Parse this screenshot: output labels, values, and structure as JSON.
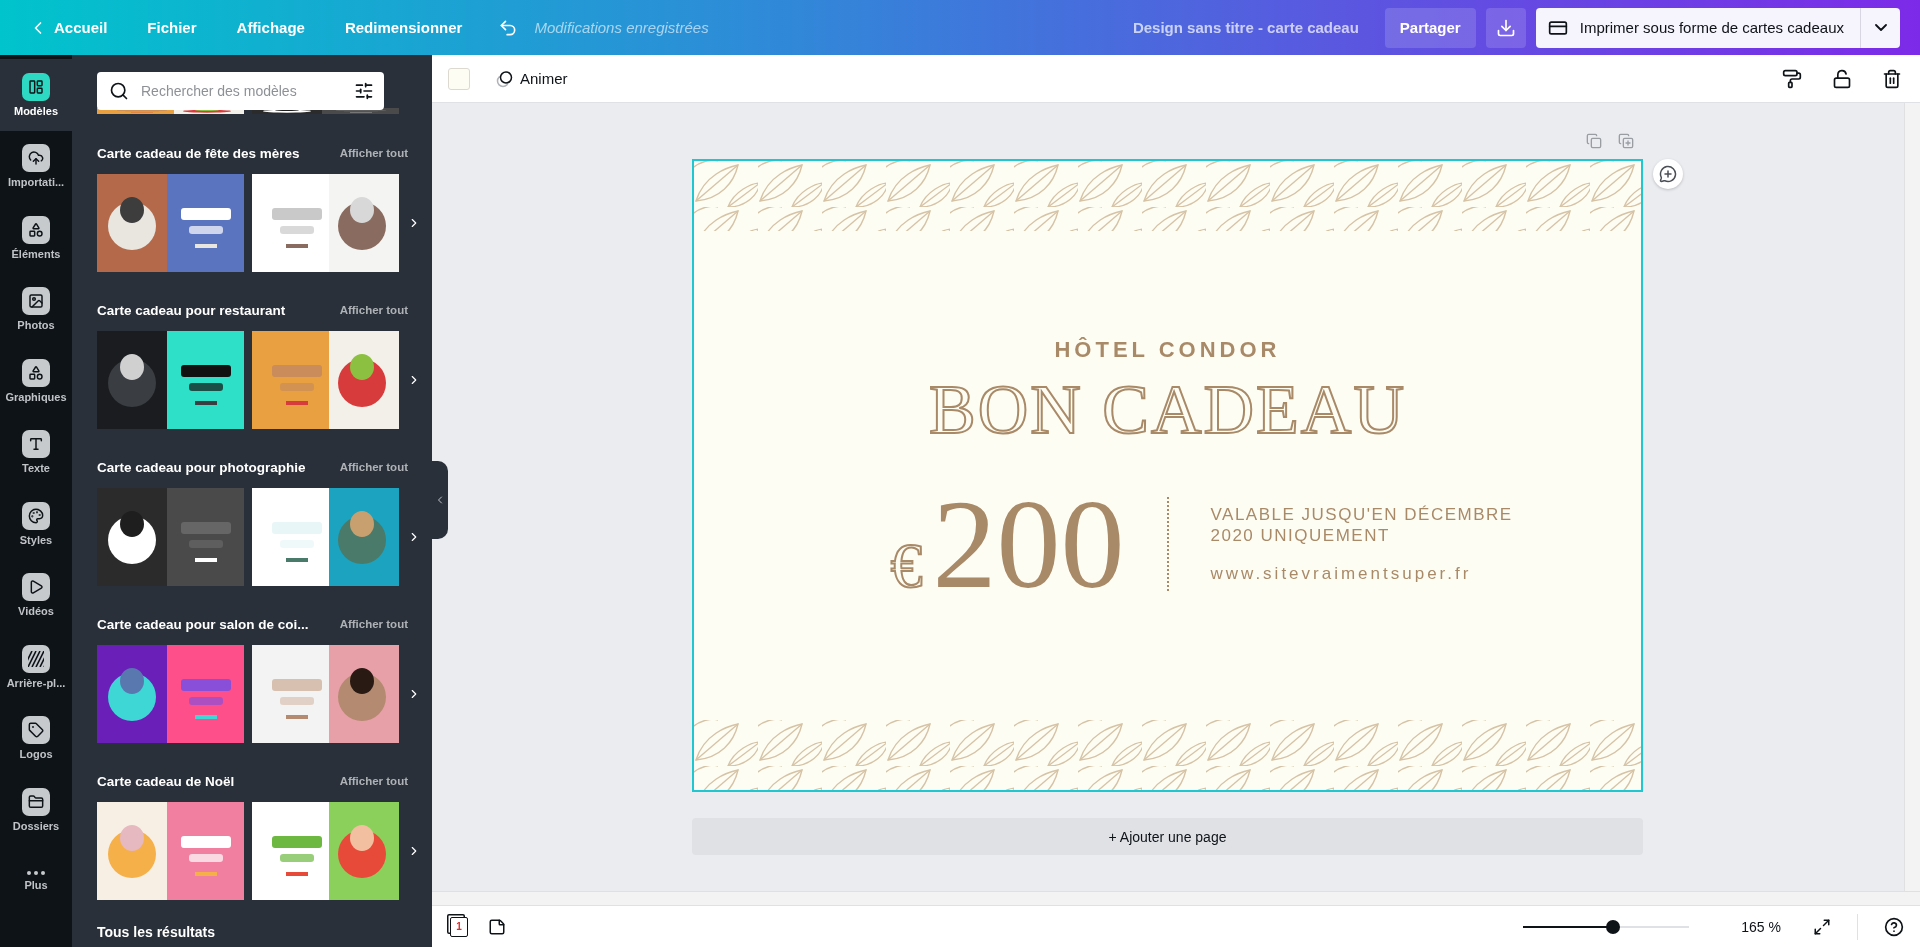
{
  "top_bar": {
    "back": "Accueil",
    "menu": [
      "Fichier",
      "Affichage",
      "Redimensionner"
    ],
    "save_status": "Modifications enregistrées",
    "design_title": "Design sans titre - carte cadeau",
    "share": "Partager",
    "print": "Imprimer sous forme de cartes cadeaux"
  },
  "side_rail": [
    {
      "label": "Modèles",
      "selected": true
    },
    {
      "label": "Importati...",
      "selected": false
    },
    {
      "label": "Éléments",
      "selected": false
    },
    {
      "label": "Photos",
      "selected": false
    },
    {
      "label": "Graphiques",
      "selected": false
    },
    {
      "label": "Texte",
      "selected": false
    },
    {
      "label": "Styles",
      "selected": false
    },
    {
      "label": "Vidéos",
      "selected": false
    },
    {
      "label": "Arrière-pl...",
      "selected": false
    },
    {
      "label": "Logos",
      "selected": false
    },
    {
      "label": "Dossiers",
      "selected": false
    },
    {
      "label": "Plus",
      "selected": false
    }
  ],
  "templates_panel": {
    "search": {
      "placeholder": "Rechercher des modèles"
    },
    "sections": [
      {
        "title": "Carte cadeau de fête des mères",
        "link": "Afficher tout"
      },
      {
        "title": "Carte cadeau pour restaurant",
        "link": "Afficher tout"
      },
      {
        "title": "Carte cadeau pour photographie",
        "link": "Afficher tout"
      },
      {
        "title": "Carte cadeau pour salon de coi...",
        "link": "Afficher tout"
      },
      {
        "title": "Carte cadeau de Noël",
        "link": "Afficher tout"
      }
    ],
    "more_heading": "Tous les résultats"
  },
  "toolbar": {
    "animate": "Animer"
  },
  "card": {
    "hotel": "HÔTEL CONDOR",
    "title": "BON CADEAU",
    "currency": "€",
    "amount": "200",
    "validity_lines": [
      "VALABLE JUSQU'EN DÉCEMBRE",
      "2020 UNIQUEMENT"
    ],
    "website": "www.sitevraimentsuper.fr"
  },
  "add_page": "+ Ajouter une page",
  "bottom_bar": {
    "page_number": "1",
    "zoom": {
      "level": 0.54,
      "reading": "165 %"
    }
  }
}
